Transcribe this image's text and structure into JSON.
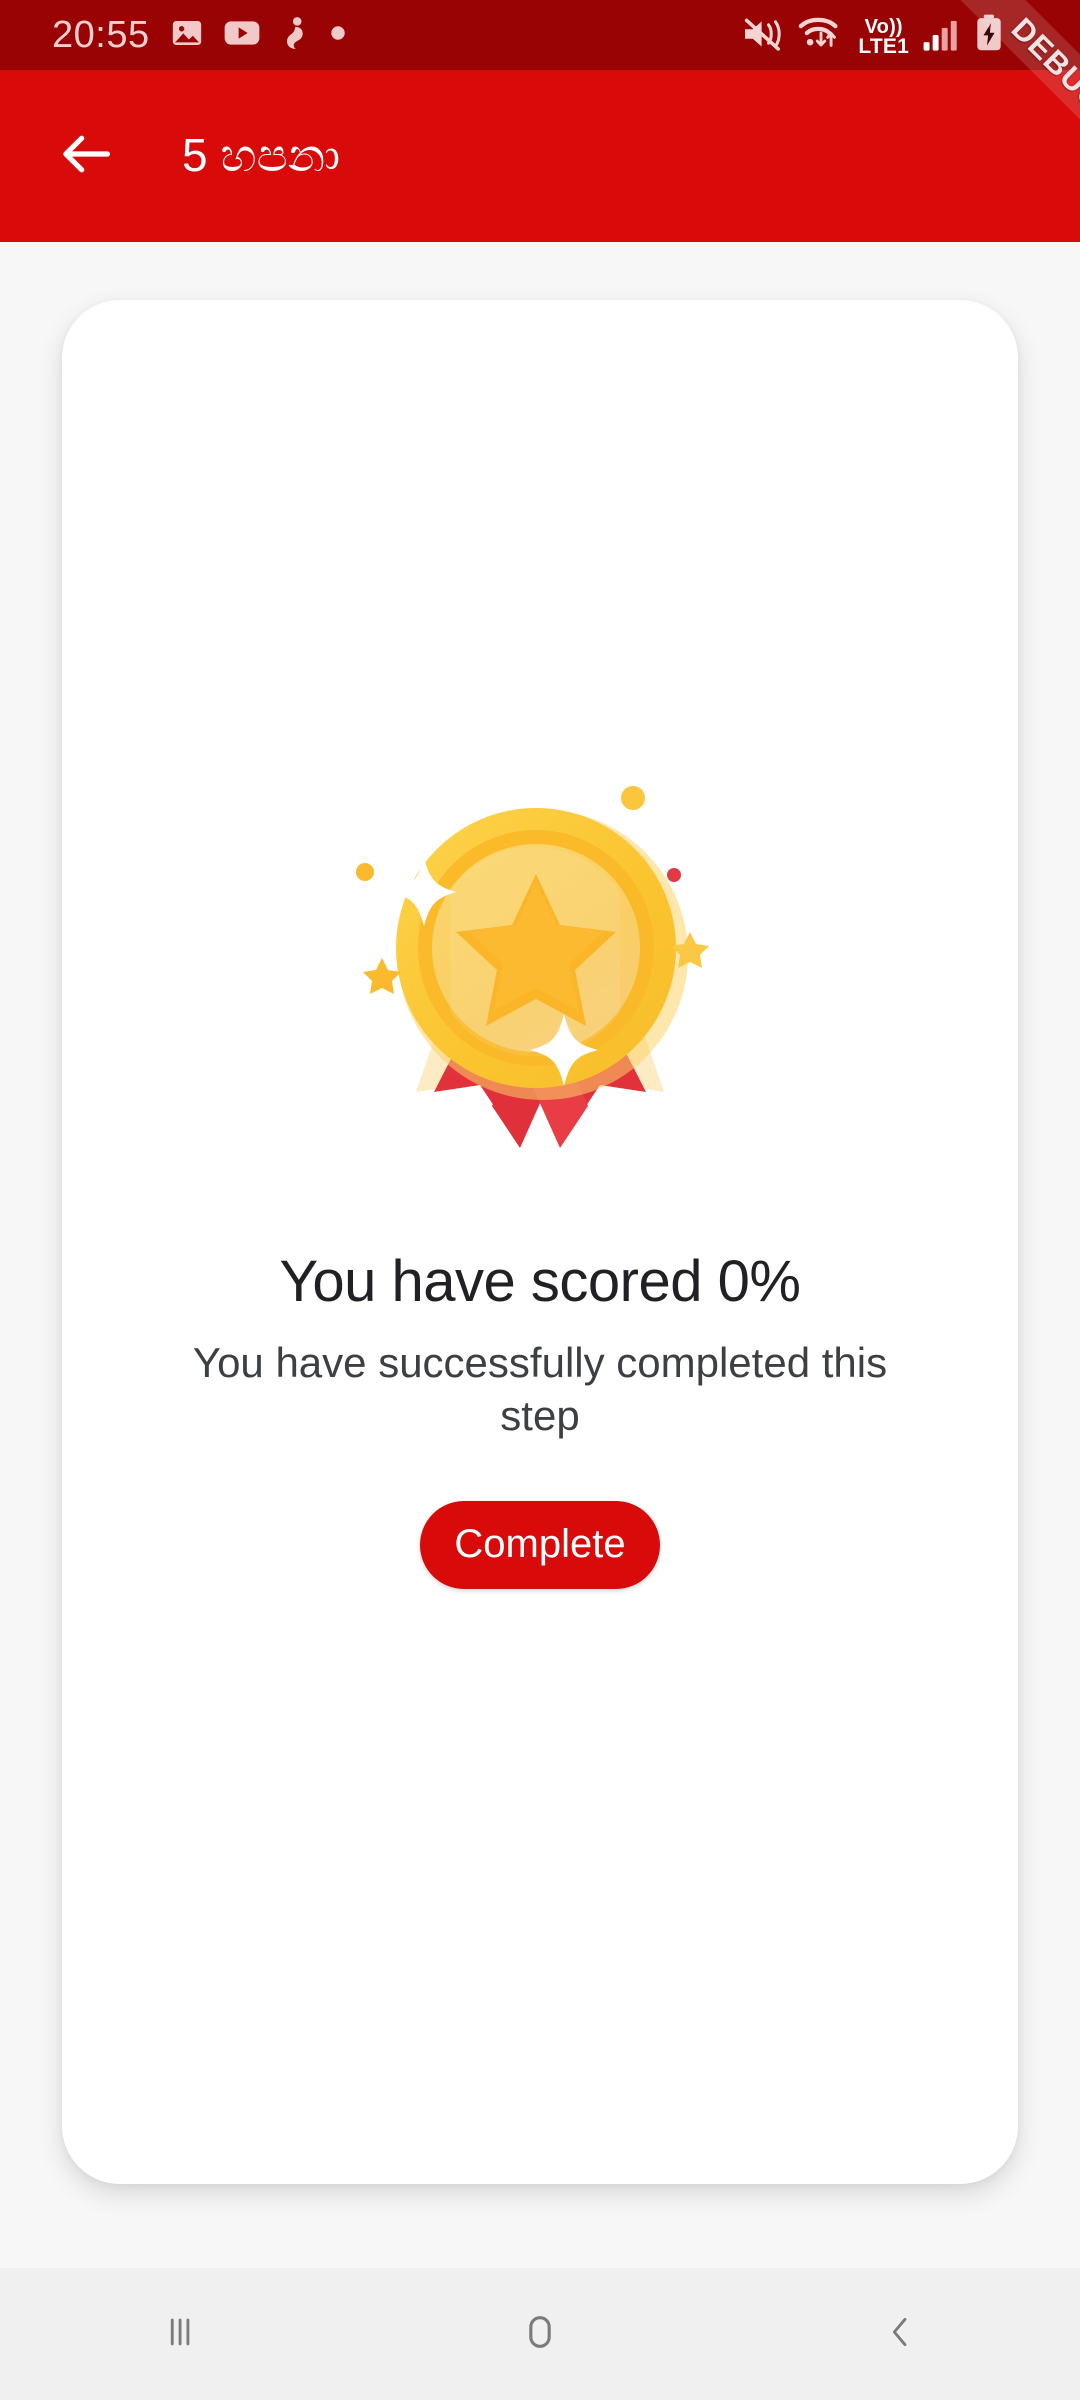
{
  "status_bar": {
    "clock": "20:55",
    "left_icons": [
      {
        "name": "gallery-icon",
        "label": "Gallery"
      },
      {
        "name": "youtube-icon",
        "label": "YouTube"
      },
      {
        "name": "app-notification-icon",
        "label": "App notification"
      },
      {
        "name": "more-notifications-dot-icon",
        "label": "More"
      }
    ],
    "right_icons": [
      {
        "name": "mute-vibrate-icon",
        "label": "Sound off / vibrate"
      },
      {
        "name": "wifi-icon",
        "label": "Wi-Fi"
      },
      {
        "name": "signal-bars-icon",
        "label": "Cellular signal"
      },
      {
        "name": "battery-charging-icon",
        "label": "Battery charging"
      }
    ],
    "volte_top": "Vo))",
    "volte_bottom": "LTE1",
    "bg_color": "#990303"
  },
  "debug_banner": {
    "label": "DEBUG"
  },
  "app_bar": {
    "title": "5 හපනා",
    "back_label": "Back",
    "bg_color": "#d80a0a"
  },
  "card": {
    "illustration_name": "award-medal-illustration",
    "heading": "You have scored 0%",
    "subtitle": "You have successfully completed this step",
    "score_percent": "0%"
  },
  "primary_button": {
    "label": "Complete",
    "bg_color": "#d80a0a",
    "text_color": "#ffffff"
  },
  "nav_bar": {
    "recents_label": "Recents",
    "home_label": "Home",
    "back_label": "Back",
    "bg_color": "#f0f0f0"
  },
  "colors": {
    "page_background": "#f7f7f7",
    "card_background": "#ffffff",
    "brand_red": "#d80a0a",
    "status_red": "#990303",
    "medal_gold": "#fbc02d",
    "ribbon_red": "#e8353f"
  }
}
